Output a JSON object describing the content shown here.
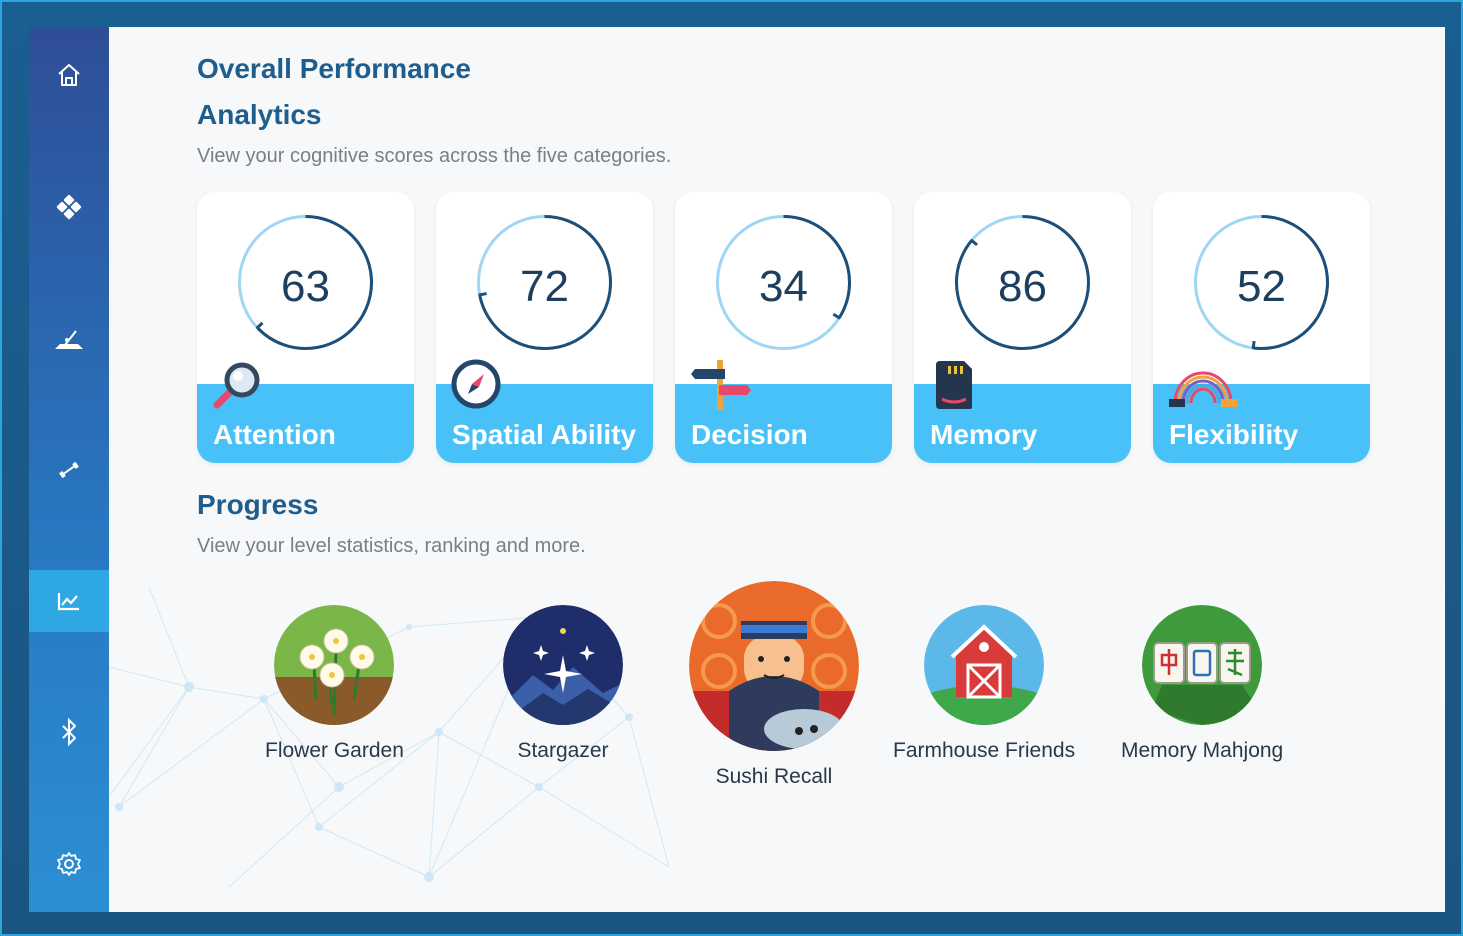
{
  "page": {
    "title": "Overall Performance",
    "analytics_heading": "Analytics",
    "analytics_desc": "View your cognitive scores across the five categories.",
    "progress_heading": "Progress",
    "progress_desc": "View your level statistics, ranking and more."
  },
  "sidebar": {
    "items": [
      {
        "icon": "home-icon"
      },
      {
        "icon": "gamepad-icon"
      },
      {
        "icon": "train-icon"
      },
      {
        "icon": "exercise-icon"
      },
      {
        "icon": "chart-icon",
        "active": true
      },
      {
        "icon": "bluetooth-icon"
      },
      {
        "icon": "settings-icon"
      }
    ]
  },
  "scores": [
    {
      "label": "Attention",
      "score": "63",
      "fraction": 0.63,
      "icon": "magnifier-icon"
    },
    {
      "label": "Spatial Ability",
      "score": "72",
      "fraction": 0.72,
      "icon": "compass-icon"
    },
    {
      "label": "Decision",
      "score": "34",
      "fraction": 0.34,
      "icon": "signpost-icon"
    },
    {
      "label": "Memory",
      "score": "86",
      "fraction": 0.86,
      "icon": "memory-card-icon"
    },
    {
      "label": "Flexibility",
      "score": "52",
      "fraction": 0.52,
      "icon": "spring-icon"
    }
  ],
  "games": [
    {
      "name": "Flower Garden",
      "icon": "flower-garden-icon"
    },
    {
      "name": "Stargazer",
      "icon": "stargazer-icon"
    },
    {
      "name": "Sushi Recall",
      "icon": "sushi-recall-icon"
    },
    {
      "name": "Farmhouse Friends",
      "icon": "farmhouse-icon"
    },
    {
      "name": "Memory Mahjong",
      "icon": "mahjong-icon"
    }
  ],
  "colors": {
    "accent": "#47c1f7",
    "ring_track": "#9fd6f5",
    "ring_fill": "#1d4f78",
    "heading": "#1f5e8c",
    "sidebar_active": "#2ea7e3"
  }
}
